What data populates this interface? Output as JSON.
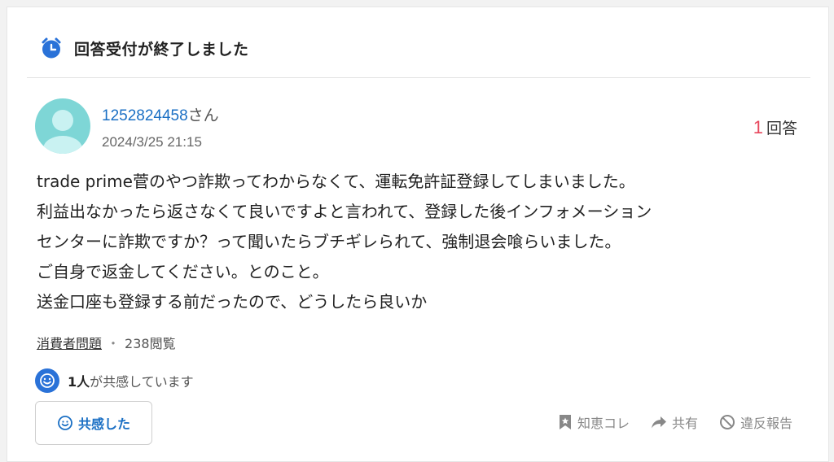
{
  "header": {
    "title": "回答受付が終了しました",
    "icon": "alarm-clock-icon",
    "icon_color": "#2a72d8"
  },
  "question": {
    "user_name": "1252824458",
    "user_suffix": "さん",
    "posted_at": "2024/3/25 21:15",
    "answer_count": "1",
    "answer_label": "回答",
    "body_lines": [
      "trade prime菅のやつ詐欺ってわからなくて、運転免許証登録してしまいました。",
      "利益出なかったら返さなくて良いですよと言われて、登録した後インフォメーション",
      "センターに詐欺ですか？って聞いたらブチギレられて、強制退会喰らいました。",
      "ご自身で返金してください。とのこと。",
      "送金口座も登録する前だったので、どうしたら良いか"
    ],
    "category": "消費者問題",
    "separator": "・",
    "views": "238閲覧"
  },
  "empathy": {
    "count": "1人",
    "suffix": "が共感しています",
    "button_label": "共感した"
  },
  "actions": {
    "chiebukuro": "知恵コレ",
    "share": "共有",
    "report": "違反報告"
  },
  "colors": {
    "link": "#1a6fc4",
    "accent_red": "#e8475c",
    "avatar": "#7ed6d6"
  }
}
